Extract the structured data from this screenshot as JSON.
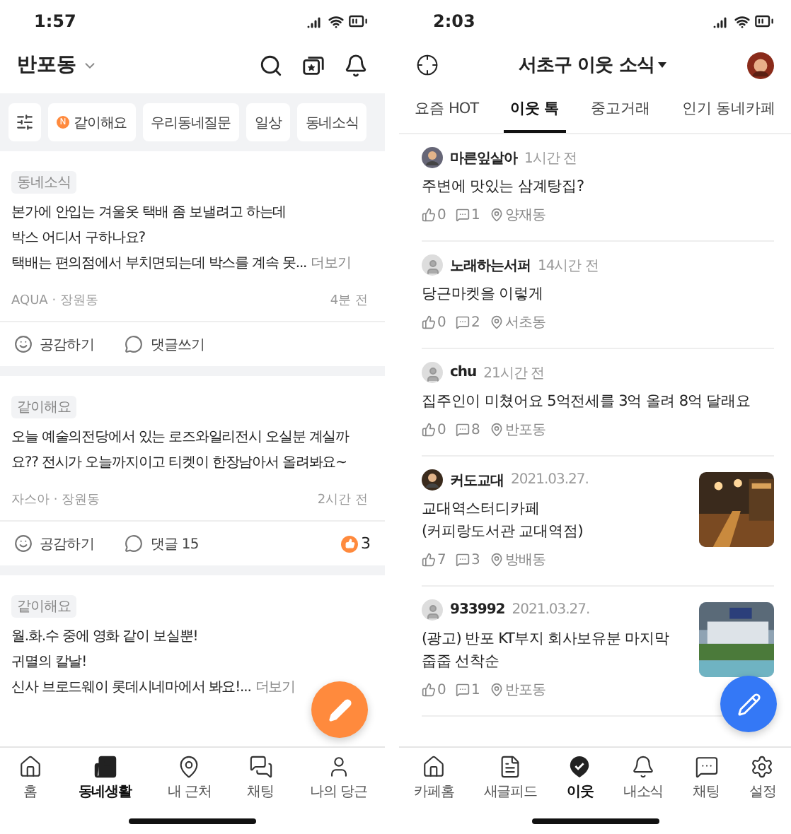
{
  "left": {
    "status_time": "1:57",
    "location": "반포동",
    "chips": [
      {
        "label": "같이해요",
        "badge": "N"
      },
      {
        "label": "우리동네질문"
      },
      {
        "label": "일상"
      },
      {
        "label": "동네소식"
      }
    ],
    "posts": [
      {
        "tag": "동네소식",
        "lines": [
          "본가에 안입는 겨울옷 택배 좀 보낼려고 하는데",
          "박스 어디서 구하나요?",
          "택배는 편의점에서 부치면되는데 박스를 계속 못..."
        ],
        "more": "더보기",
        "byline": "AQUA · 장원동",
        "time": "4분 전",
        "actions": [
          "공감하기",
          "댓글쓰기"
        ]
      },
      {
        "tag": "같이해요",
        "lines": [
          "오늘 예술의전당에서 있는 로즈와일리전시 오실분 계실까요?? 전시가 오늘까지이고 티켓이 한장남아서 올려봐요~"
        ],
        "byline": "자스아 · 장원동",
        "time": "2시간 전",
        "actions": [
          "공감하기",
          "댓글 15"
        ],
        "likes": "3"
      },
      {
        "tag": "같이해요",
        "lines": [
          "월.화.수 중에 영화 같이 보실뿐!",
          "귀멸의 칼날!",
          "신사 브로드웨이 롯데시네마에서 봐요!..."
        ],
        "more": "더보기"
      }
    ],
    "nav": [
      {
        "label": "홈",
        "selected": false
      },
      {
        "label": "동네생활",
        "selected": true
      },
      {
        "label": "내 근처",
        "selected": false
      },
      {
        "label": "채팅",
        "selected": false
      },
      {
        "label": "나의 당근",
        "selected": false
      }
    ]
  },
  "right": {
    "status_time": "2:03",
    "title": "서초구 이웃 소식",
    "tabs": [
      {
        "label": "요즘 HOT",
        "selected": false
      },
      {
        "label": "이웃 톡",
        "selected": true
      },
      {
        "label": "중고거래",
        "selected": false
      },
      {
        "label": "인기 동네카페",
        "selected": false
      }
    ],
    "posts": [
      {
        "author": "마른잎살아",
        "time": "1시간 전",
        "title": "주변에 맛있는 삼계탕집?",
        "likes": "0",
        "comments": "1",
        "place": "양재동",
        "thumbnail": false
      },
      {
        "author": "노래하는서퍼",
        "time": "14시간 전",
        "title": "당근마켓을 이렇게",
        "likes": "0",
        "comments": "2",
        "place": "서초동",
        "avatar": {
          "kind": "default"
        },
        "thumbnail": false
      },
      {
        "author": "chu",
        "time": "21시간 전",
        "title": "집주인이 미쳤어요 5억전세를 3억 올려 8억 달래요",
        "likes": "0",
        "comments": "8",
        "place": "반포동",
        "avatar": {
          "kind": "default"
        },
        "thumbnail": false
      },
      {
        "author": "커도교대",
        "time": "2021.03.27.",
        "title": "교대역스터디카페\n(커피랑도서관 교대역점)",
        "likes": "7",
        "comments": "3",
        "place": "방배동",
        "thumbnail": true
      },
      {
        "author": "933992",
        "time": "2021.03.27.",
        "title": "(광고) 반포 KT부지 회사보유분 마지막\n줍줍 선착순",
        "likes": "0",
        "comments": "1",
        "place": "반포동",
        "avatar": {
          "kind": "default"
        },
        "thumbnail": true
      }
    ],
    "nav": [
      {
        "label": "카페홈",
        "selected": false
      },
      {
        "label": "새글피드",
        "selected": false
      },
      {
        "label": "이웃",
        "selected": true
      },
      {
        "label": "내소식",
        "selected": false
      },
      {
        "label": "채팅",
        "selected": false
      },
      {
        "label": "설정",
        "selected": false
      }
    ]
  }
}
